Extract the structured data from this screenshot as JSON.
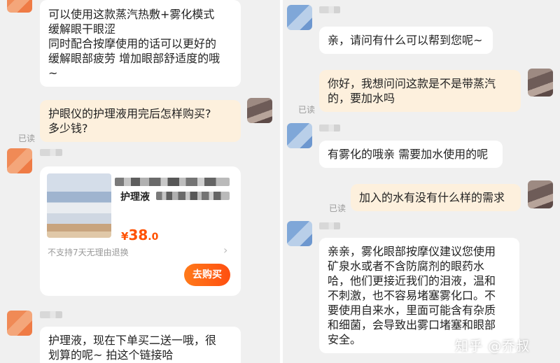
{
  "left": {
    "msg1": "可以使用这款蒸汽热敷+雾化模式\n缓解眼干眼涩\n同时配合按摩使用的话可以更好的\n缓解眼部疲劳 增加眼部舒适度的哦\n~",
    "msg2": "护眼仪的护理液用完后怎样购买?\n多少钱?",
    "msg2_read": "已读",
    "product": {
      "title": "护理液",
      "price_symbol": "¥",
      "price_int": "38",
      "price_dec": ".0",
      "note": "不支持7天无理由退换",
      "chevron": "›",
      "buy_label": "去购买"
    },
    "msg3": "护理液，现在下单买二送一哦，很\n划算的呢~ 拍这个链接哈"
  },
  "right": {
    "msg1": "亲，请问有什么可以帮到您呢~",
    "msg2": "你好，我想问问这款是不是带蒸汽\n的，要加水吗",
    "msg2_read": "已读",
    "msg3": "有雾化的哦亲 需要加水使用的呢",
    "msg4": "加入的水有没有什么样的需求",
    "msg4_read": "已读",
    "msg5": "亲亲，雾化眼部按摩仪建议您使用\n矿泉水或者不含防腐剂的眼药水\n哈，他们更接近我们的泪液，温和\n不刺激，也不容易堵塞雾化口。不\n要使用自来水，里面可能含有杂质\n和细菌，会导致出雾口堵塞和眼部\n安全。"
  },
  "watermark": "知乎 @乔叔",
  "colors": {
    "accent": "#ff5000",
    "self_bubble": "#fdf0dd",
    "background": "#f0f0f0"
  }
}
